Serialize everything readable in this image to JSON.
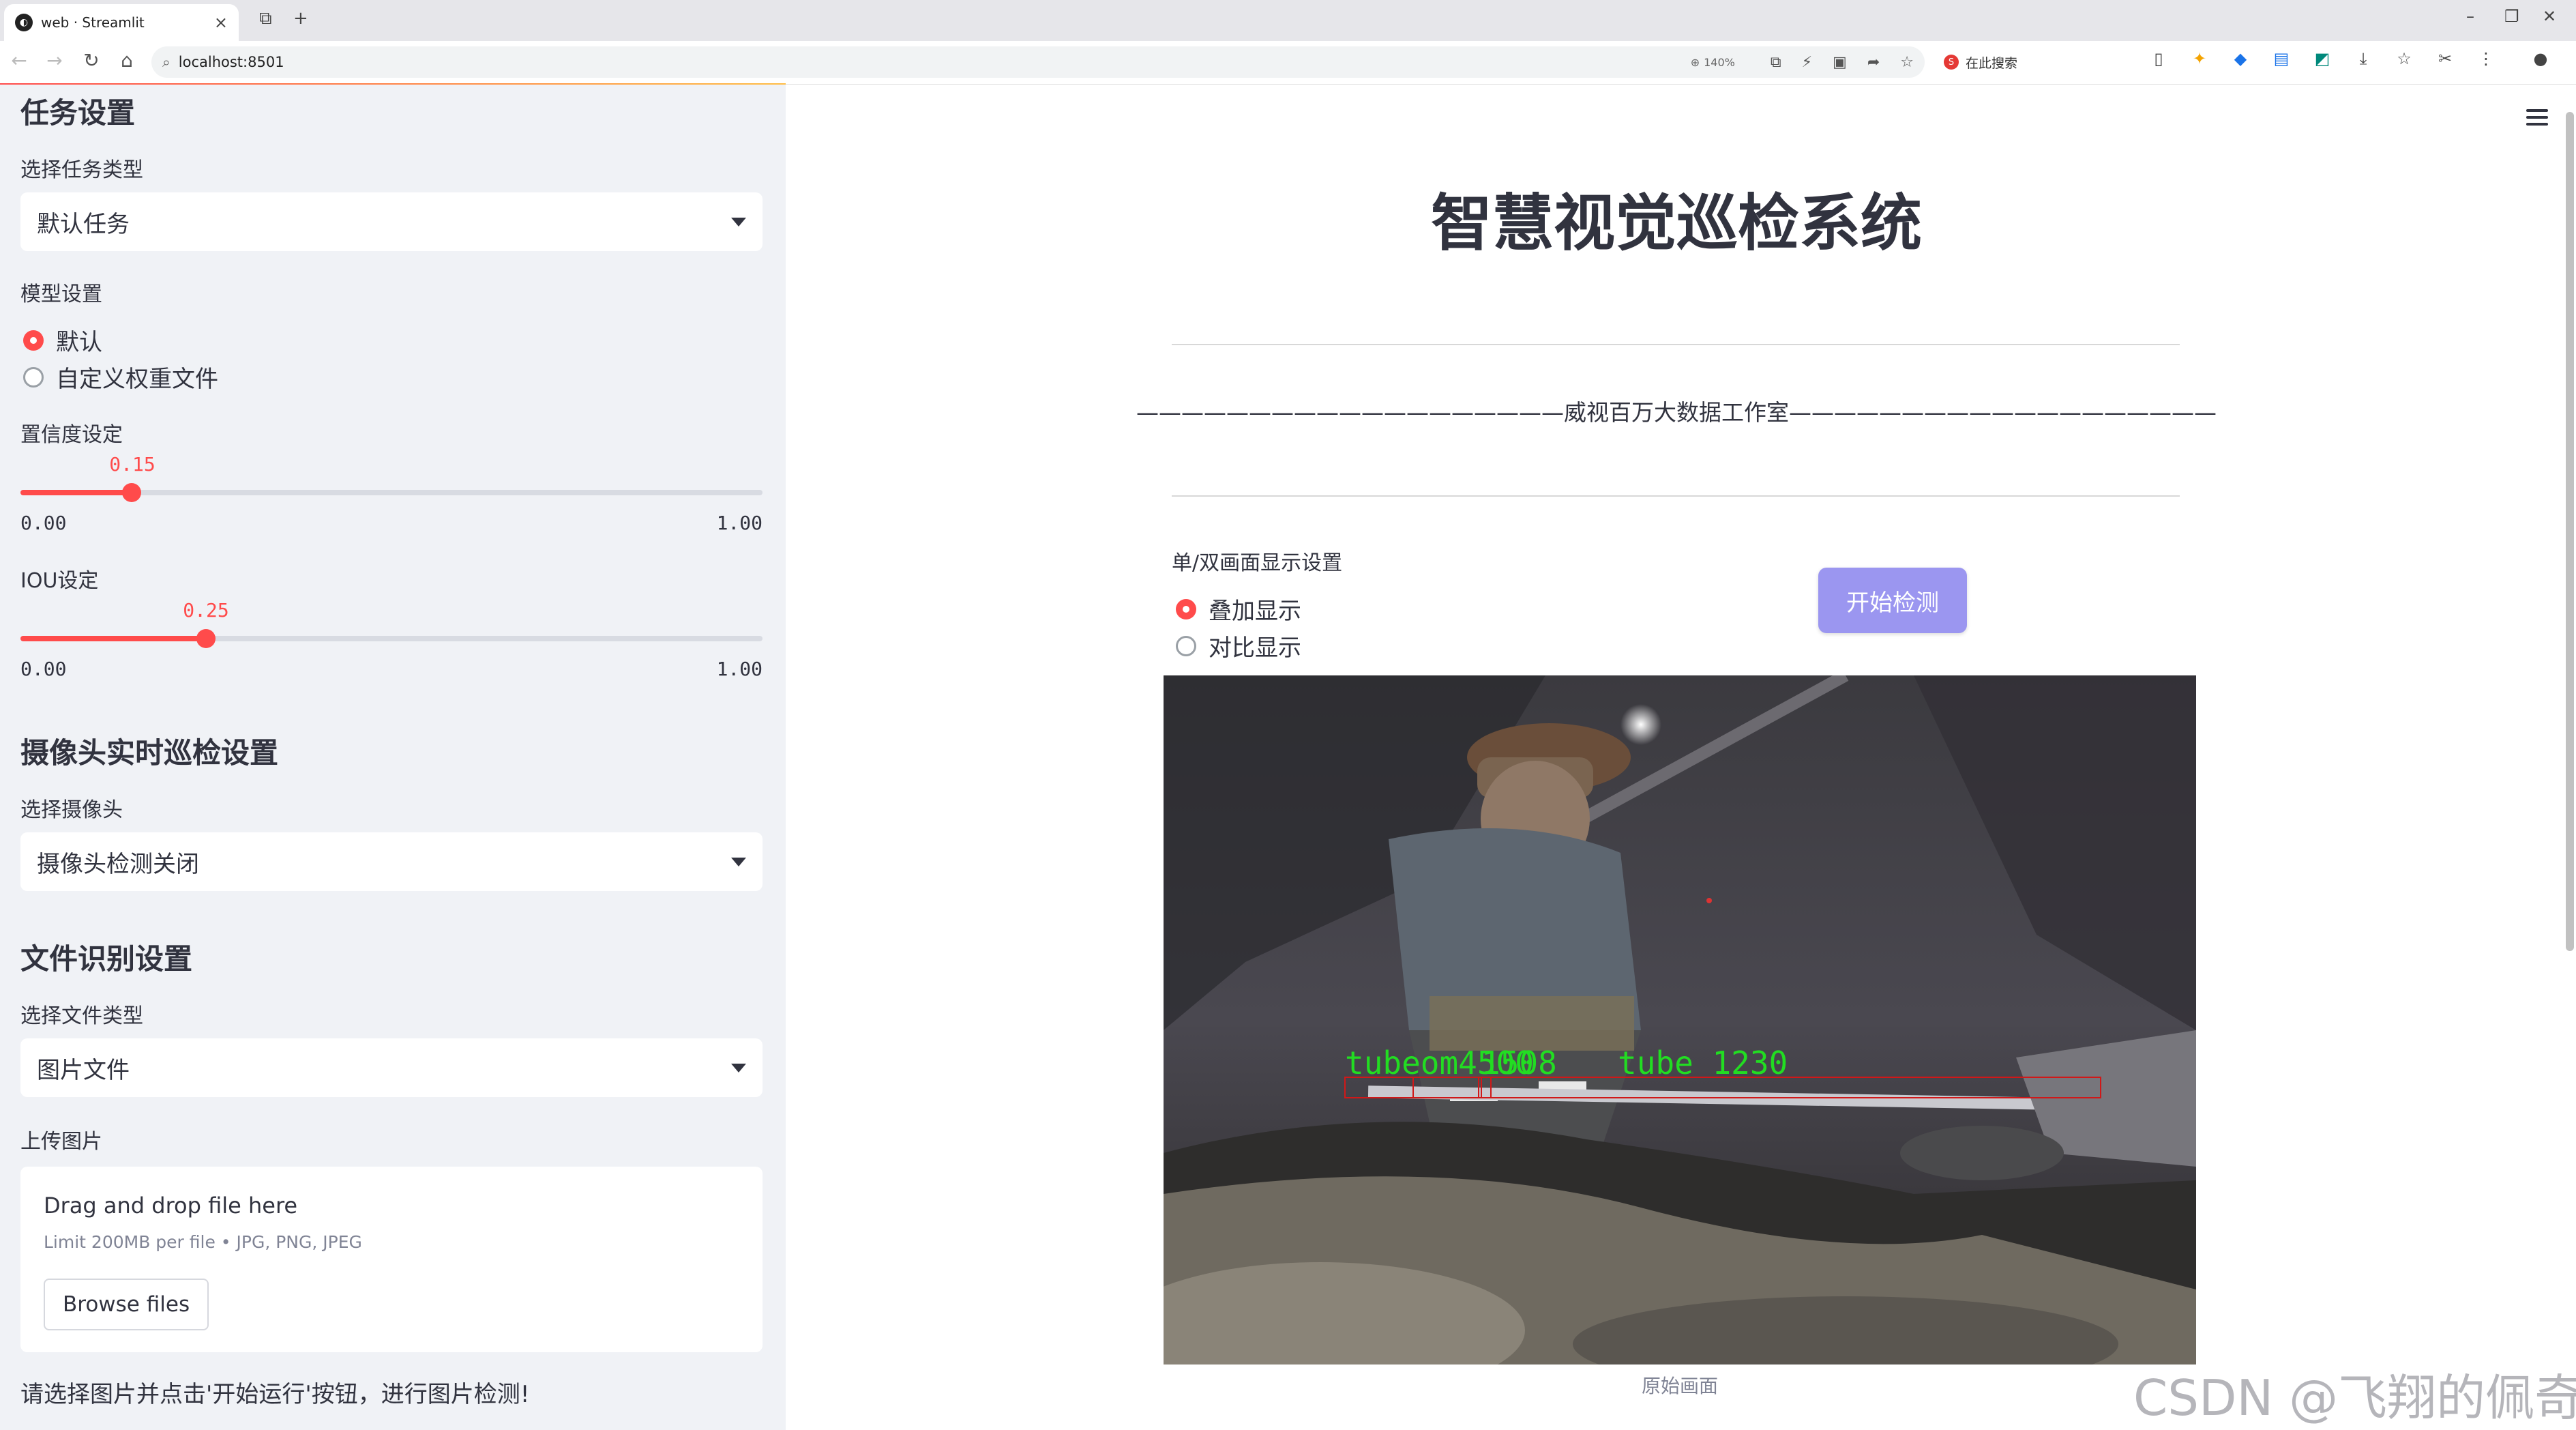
{
  "browser": {
    "tab_title": "web · Streamlit",
    "url": "localhost:8501",
    "zoom": "140%",
    "search_text": "在此搜索"
  },
  "sidebar": {
    "task_section_title": "任务设置",
    "task_type_label": "选择任务类型",
    "task_type_value": "默认任务",
    "model_label": "模型设置",
    "model_options": [
      "默认",
      "自定义权重文件"
    ],
    "model_selected": "默认",
    "confidence": {
      "label": "置信度设定",
      "value": "0.15",
      "min": "0.00",
      "max": "1.00",
      "fraction": 0.15
    },
    "iou": {
      "label": "IOU设定",
      "value": "0.25",
      "min": "0.00",
      "max": "1.00",
      "fraction": 0.25
    },
    "camera_section_title": "摄像头实时巡检设置",
    "camera_label": "选择摄像头",
    "camera_value": "摄像头检测关闭",
    "file_section_title": "文件识别设置",
    "file_type_label": "选择文件类型",
    "file_type_value": "图片文件",
    "upload_label": "上传图片",
    "upload_main": "Drag and drop file here",
    "upload_sub": "Limit 200MB per file • JPG, PNG, JPEG",
    "browse_label": "Browse files",
    "hint": "请选择图片并点击'开始运行'按钮，进行图片检测!"
  },
  "main": {
    "title": "智慧视觉巡检系统",
    "studio_line": "———————————————————威视百万大数据工作室———————————————————",
    "display_label": "单/双画面显示设置",
    "display_options": [
      "叠加显示",
      "对比显示"
    ],
    "display_selected": "叠加显示",
    "start_button": "开始检测",
    "detection_label_1": "tubeom4500",
    "detection_label_2": "tube 1230",
    "detection_label_3": "1508",
    "image_caption": "原始画面",
    "watermark": "CSDN @飞翔的佩奇"
  },
  "colors": {
    "accent": "#ff4b4b",
    "button": "#9b96f0",
    "sidebar_bg": "#f0f2f6",
    "detect_text": "#22dd22",
    "detect_box": "#d01818"
  },
  "icons": [
    "streamlit-favicon",
    "back-icon",
    "forward-icon",
    "reload-icon",
    "home-icon",
    "zoom-icon",
    "hamburger-icon",
    "caret-down-icon"
  ]
}
